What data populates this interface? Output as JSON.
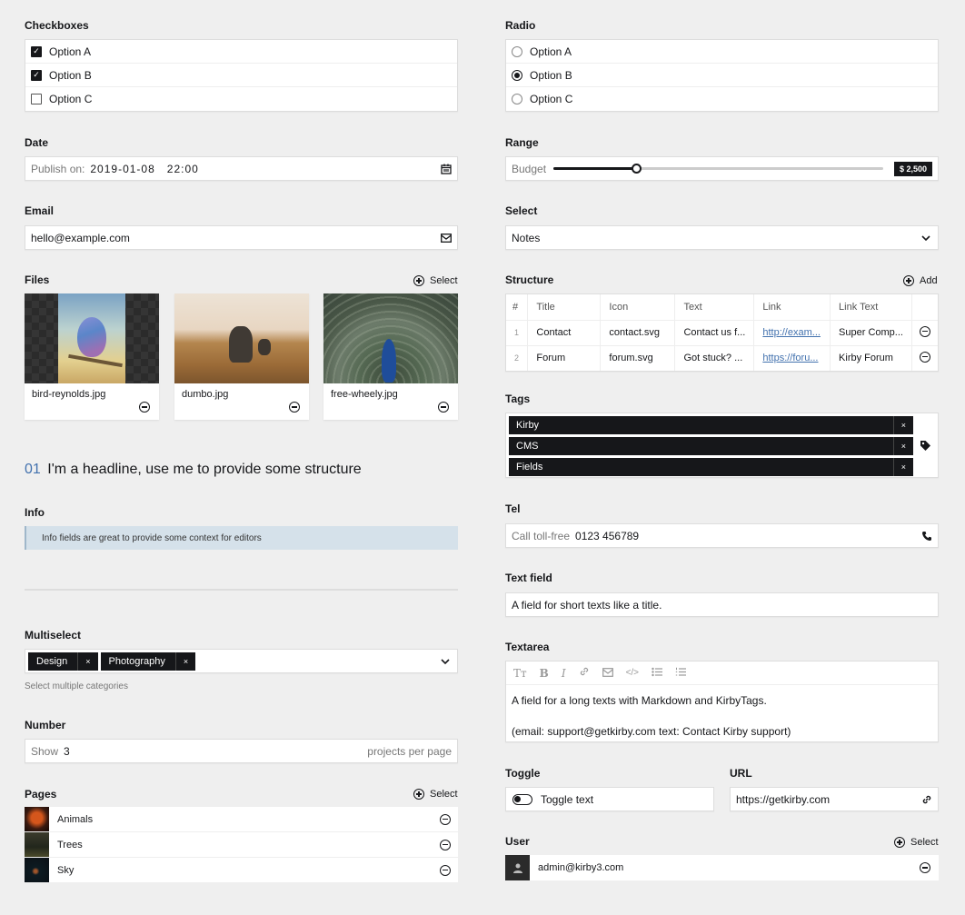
{
  "checkboxes": {
    "label": "Checkboxes",
    "options": [
      {
        "label": "Option A",
        "checked": true
      },
      {
        "label": "Option B",
        "checked": true
      },
      {
        "label": "Option C",
        "checked": false
      }
    ]
  },
  "radio": {
    "label": "Radio",
    "options": [
      {
        "label": "Option A",
        "selected": false
      },
      {
        "label": "Option B",
        "selected": true
      },
      {
        "label": "Option C",
        "selected": false
      }
    ]
  },
  "date": {
    "label": "Date",
    "prefix": "Publish on:",
    "date": "2019-01-08",
    "time": "22:00",
    "icon": "calendar-icon"
  },
  "range": {
    "label": "Range",
    "prefix": "Budget",
    "value": 2500,
    "max": 10000,
    "fill_fraction": 0.25,
    "display": "$ 2,500"
  },
  "email": {
    "label": "Email",
    "value": "hello@example.com",
    "icon": "envelope-icon"
  },
  "select": {
    "label": "Select",
    "value": "Notes"
  },
  "files": {
    "label": "Files",
    "action": "Select",
    "items": [
      {
        "name": "bird-reynolds.jpg"
      },
      {
        "name": "dumbo.jpg"
      },
      {
        "name": "free-wheely.jpg"
      }
    ]
  },
  "structure": {
    "label": "Structure",
    "action": "Add",
    "columns": [
      "#",
      "Title",
      "Icon",
      "Text",
      "Link",
      "Link Text"
    ],
    "rows": [
      {
        "num": "1",
        "title": "Contact",
        "icon": "contact.svg",
        "text": "Contact us f...",
        "link": "http://exam...",
        "link_text": "Super Comp..."
      },
      {
        "num": "2",
        "title": "Forum",
        "icon": "forum.svg",
        "text": "Got stuck? ...",
        "link": "https://foru...",
        "link_text": "Kirby Forum"
      }
    ]
  },
  "headline": {
    "number": "01",
    "text": "I'm a headline, use me to provide some structure"
  },
  "tags": {
    "label": "Tags",
    "items": [
      "Kirby",
      "CMS",
      "Fields"
    ],
    "remove": "×"
  },
  "info": {
    "label": "Info",
    "text": "Info fields are great to provide some context for editors"
  },
  "tel": {
    "label": "Tel",
    "prefix": "Call toll-free",
    "value": "0123 456789"
  },
  "textfield": {
    "label": "Text field",
    "value": "A field for short texts like a title."
  },
  "multiselect": {
    "label": "Multiselect",
    "items": [
      "Design",
      "Photography"
    ],
    "remove": "×",
    "help": "Select multiple categories"
  },
  "textarea": {
    "label": "Textarea",
    "line1": "A field for a long texts with Markdown and KirbyTags.",
    "line2": "(email: support@getkirby.com text: Contact Kirby support)"
  },
  "number": {
    "label": "Number",
    "prefix": "Show",
    "value": "3",
    "suffix": "projects per page"
  },
  "toggle": {
    "label": "Toggle",
    "text": "Toggle text",
    "on": true
  },
  "url": {
    "label": "URL",
    "value": "https://getkirby.com"
  },
  "pages": {
    "label": "Pages",
    "action": "Select",
    "items": [
      "Animals",
      "Trees",
      "Sky"
    ]
  },
  "user": {
    "label": "User",
    "action": "Select",
    "email": "admin@kirby3.com"
  }
}
